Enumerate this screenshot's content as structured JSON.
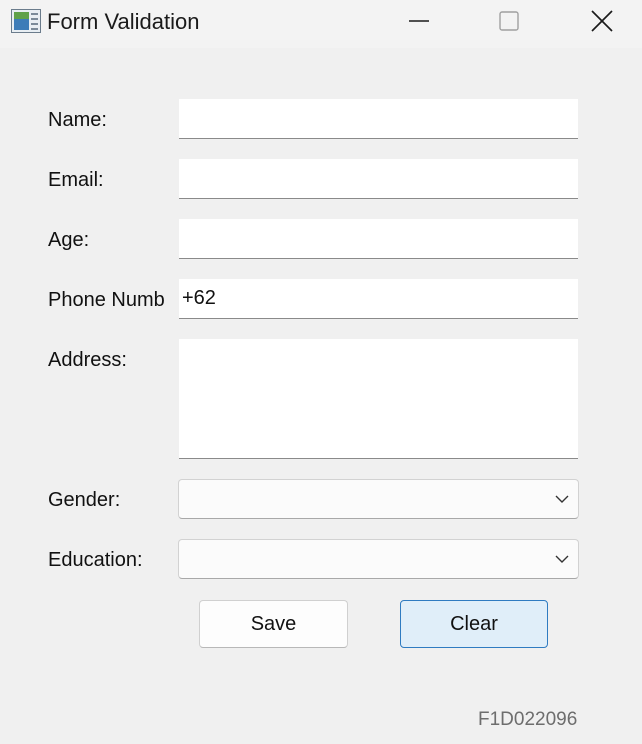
{
  "window": {
    "title": "Form Validation",
    "icon": "form-app-icon"
  },
  "form": {
    "name_label": "Name:",
    "name_value": "",
    "email_label": "Email:",
    "email_value": "",
    "age_label": "Age:",
    "age_value": "",
    "phone_label": "Phone Numb",
    "phone_value": "+62",
    "address_label": "Address:",
    "address_value": "",
    "gender_label": "Gender:",
    "gender_value": "",
    "education_label": "Education:",
    "education_value": ""
  },
  "buttons": {
    "save_label": "Save",
    "clear_label": "Clear"
  },
  "footer": {
    "code": "F1D022096"
  },
  "colors": {
    "background": "#f0f0f0",
    "focus_accent": "#2f7bc1",
    "focus_fill": "#e0eef9"
  }
}
